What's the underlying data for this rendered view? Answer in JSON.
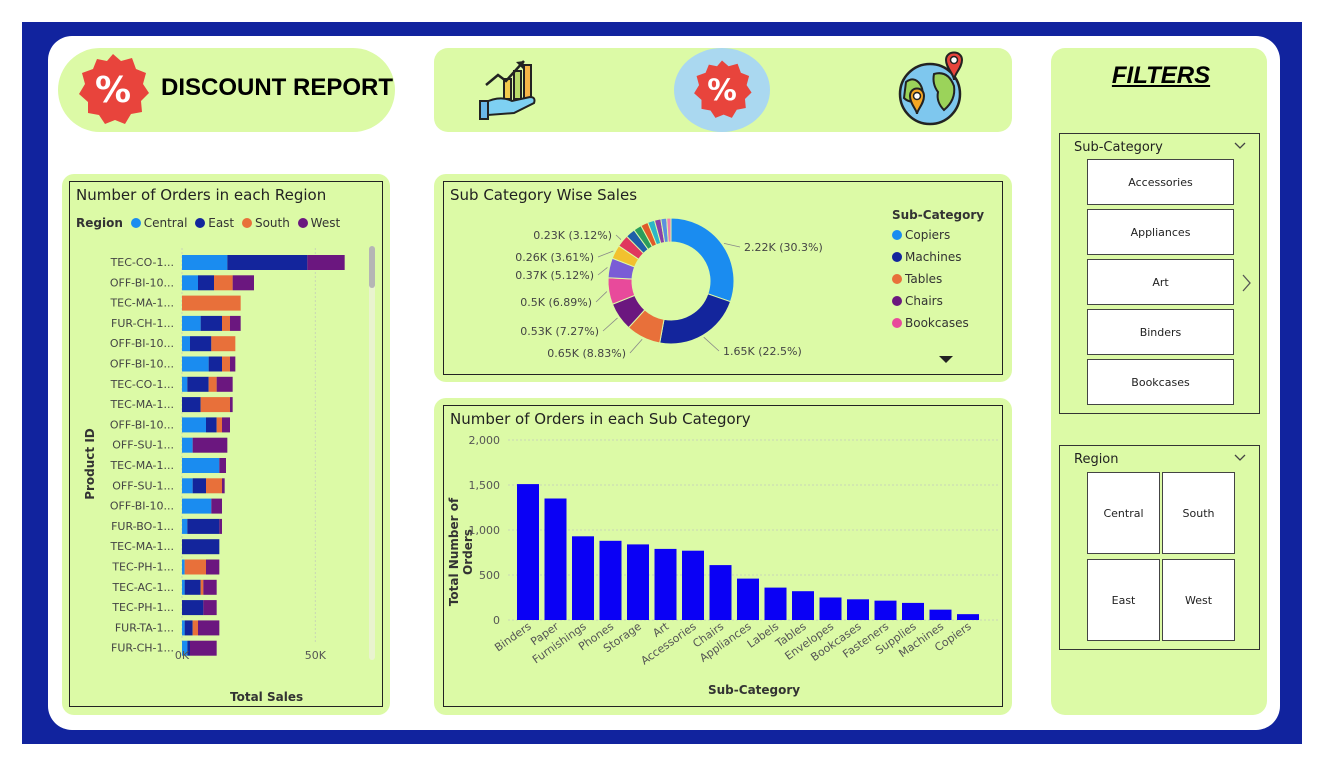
{
  "header": {
    "title": "DISCOUNT REPORT",
    "icons": [
      "percent-badge-icon",
      "growth-chart-hand-icon",
      "percent-badge-icon",
      "globe-location-icon"
    ]
  },
  "colors": {
    "panel": "#dcfaa6",
    "frame": "#11239e",
    "bar_blue": "#0a00f5",
    "central": "#1a8cf0",
    "east": "#13259c",
    "south": "#e8703a",
    "west": "#6b177f",
    "badge_red": "#e8443c"
  },
  "region_chart": {
    "title": "Number of Orders in each Region",
    "legend_title": "Region",
    "legend": [
      {
        "name": "Central",
        "color": "#1a8cf0"
      },
      {
        "name": "East",
        "color": "#13259c"
      },
      {
        "name": "South",
        "color": "#e8703a"
      },
      {
        "name": "West",
        "color": "#6b177f"
      }
    ],
    "y_axis_label": "Product ID",
    "x_axis_label": "Total Sales",
    "x_ticks": [
      "0K",
      "50K"
    ]
  },
  "subcat_sales": {
    "title": "Sub Category Wise Sales",
    "legend_title": "Sub-Category",
    "legend": [
      {
        "name": "Copiers",
        "color": "#1a8cf0"
      },
      {
        "name": "Machines",
        "color": "#13259c"
      },
      {
        "name": "Tables",
        "color": "#e8703a"
      },
      {
        "name": "Chairs",
        "color": "#6b177f"
      },
      {
        "name": "Bookcases",
        "color": "#e84a9b"
      }
    ],
    "labels": [
      "2.22K (30.3%)",
      "1.65K (22.5%)",
      "0.65K (8.83%)",
      "0.53K (7.27%)",
      "0.5K (6.89%)",
      "0.37K (5.12%)",
      "0.26K (3.61%)",
      "0.23K (3.12%)"
    ]
  },
  "orders_chart": {
    "title": "Number of Orders in each Sub Category",
    "y_axis_label": "Total Number of Orders",
    "x_axis_label": "Sub-Category"
  },
  "filters": {
    "title": "FILTERS",
    "subcategory": {
      "label": "Sub-Category",
      "options": [
        "Accessories",
        "Appliances",
        "Art",
        "Binders",
        "Bookcases"
      ]
    },
    "region": {
      "label": "Region",
      "options": [
        "Central",
        "South",
        "East",
        "West"
      ]
    }
  },
  "chart_data": [
    {
      "type": "bar",
      "orientation": "horizontal",
      "stacked": true,
      "title": "Number of Orders in each Region",
      "xlabel": "Total Sales",
      "ylabel": "Product ID",
      "xlim": [
        0,
        75000
      ],
      "grid": true,
      "legend_position": "top-left",
      "categories": [
        "TEC-CO-1...",
        "OFF-BI-10...",
        "TEC-MA-1...",
        "FUR-CH-1...",
        "OFF-BI-10...",
        "OFF-BI-10...",
        "TEC-CO-1...",
        "TEC-MA-1...",
        "OFF-BI-10...",
        "OFF-SU-1...",
        "TEC-MA-1...",
        "OFF-SU-1...",
        "OFF-BI-10...",
        "FUR-BO-1...",
        "TEC-MA-1...",
        "TEC-PH-1...",
        "TEC-AC-1...",
        "TEC-PH-1...",
        "FUR-TA-1...",
        "FUR-CH-1..."
      ],
      "series": [
        {
          "name": "Central",
          "values": [
            17000,
            6000,
            0,
            7000,
            3000,
            10000,
            2000,
            0,
            9000,
            4000,
            14000,
            4000,
            11000,
            2000,
            0,
            1000,
            1000,
            0,
            1000,
            2000
          ]
        },
        {
          "name": "East",
          "values": [
            30000,
            6000,
            0,
            8000,
            8000,
            5000,
            8000,
            7000,
            4000,
            0,
            0,
            5000,
            0,
            12000,
            14000,
            0,
            6000,
            8000,
            3000,
            1000
          ]
        },
        {
          "name": "South",
          "values": [
            0,
            7000,
            22000,
            3000,
            9000,
            3000,
            3000,
            11000,
            2000,
            0,
            0,
            6000,
            0,
            0,
            0,
            8000,
            1000,
            0,
            2000,
            0
          ]
        },
        {
          "name": "West",
          "values": [
            14000,
            8000,
            0,
            4000,
            0,
            2000,
            6000,
            1000,
            3000,
            13000,
            2500,
            1000,
            4000,
            1000,
            0,
            5000,
            5000,
            5000,
            8000,
            10000
          ]
        }
      ]
    },
    {
      "type": "pie",
      "donut": true,
      "title": "Sub Category Wise Sales",
      "legend_position": "right",
      "slices": [
        {
          "name": "Copiers",
          "value": 2220,
          "percent": 30.3
        },
        {
          "name": "Machines",
          "value": 1650,
          "percent": 22.5
        },
        {
          "name": "Tables",
          "value": 650,
          "percent": 8.83
        },
        {
          "name": "Chairs",
          "value": 530,
          "percent": 7.27
        },
        {
          "name": "Bookcases",
          "value": 500,
          "percent": 6.89
        },
        {
          "name": "",
          "value": 370,
          "percent": 5.12
        },
        {
          "name": "",
          "value": 260,
          "percent": 3.61
        },
        {
          "name": "",
          "value": 230,
          "percent": 3.12
        },
        {
          "name": "",
          "value": 180,
          "percent": 2.5
        },
        {
          "name": "",
          "value": 150,
          "percent": 2.0
        },
        {
          "name": "",
          "value": 140,
          "percent": 1.9
        },
        {
          "name": "",
          "value": 130,
          "percent": 1.8
        },
        {
          "name": "",
          "value": 120,
          "percent": 1.6
        },
        {
          "name": "",
          "value": 110,
          "percent": 1.5
        },
        {
          "name": "",
          "value": 80,
          "percent": 1.1
        }
      ]
    },
    {
      "type": "bar",
      "title": "Number of Orders in each Sub Category",
      "xlabel": "Sub-Category",
      "ylabel": "Total Number of Orders",
      "ylim": [
        0,
        2000
      ],
      "yticks": [
        "0",
        "500",
        "1,000",
        "1,500",
        "2,000"
      ],
      "grid": true,
      "categories": [
        "Binders",
        "Paper",
        "Furnishings",
        "Phones",
        "Storage",
        "Art",
        "Accessories",
        "Chairs",
        "Appliances",
        "Labels",
        "Tables",
        "Envelopes",
        "Bookcases",
        "Fasteners",
        "Supplies",
        "Machines",
        "Copiers"
      ],
      "values": [
        1510,
        1350,
        930,
        880,
        840,
        790,
        770,
        610,
        460,
        360,
        320,
        250,
        230,
        215,
        190,
        115,
        65
      ]
    }
  ]
}
